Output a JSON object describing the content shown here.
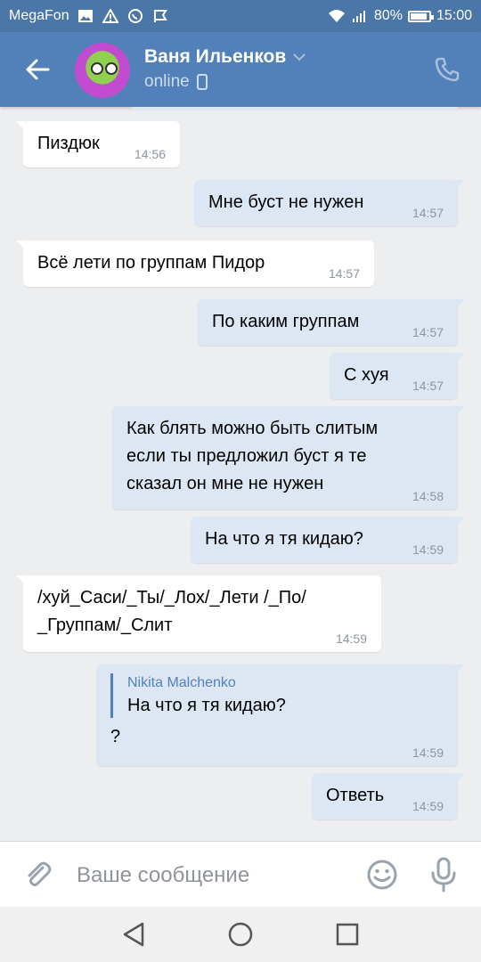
{
  "status_bar": {
    "carrier": "MegaFon",
    "battery": "80%",
    "time": "15:00"
  },
  "header": {
    "contact_name": "Ваня Ильенков",
    "status": "online",
    "icons": {
      "back": "arrow-left-icon",
      "call": "phone-icon",
      "dropdown": "chevron-down-icon",
      "device": "mobile-icon"
    }
  },
  "messages": [
    {
      "dir": "in",
      "text": "Пиздюк",
      "time": "14:56"
    },
    {
      "dir": "out",
      "text": "Мне буст не нужен",
      "time": "14:57"
    },
    {
      "dir": "in",
      "text": "Всё лети по группам Пидор",
      "time": "14:57"
    },
    {
      "dir": "out",
      "text": "По каким группам",
      "time": "14:57"
    },
    {
      "dir": "out",
      "text": "С хуя",
      "time": "14:57"
    },
    {
      "dir": "out",
      "text": "Как блять можно быть слитым\nесли ты предложил буст я те\nсказал он мне не нужен",
      "time": "14:58"
    },
    {
      "dir": "out",
      "text": "На что я тя кидаю?",
      "time": "14:59"
    },
    {
      "dir": "in",
      "text": "/хуй_Саси/_Ты/_Лох/_Лети /_По/\n_Группам/_Слит",
      "time": "14:59"
    },
    {
      "dir": "out",
      "reply_author": "Nikita Malchenko",
      "reply_text": "На что я тя кидаю?",
      "text": "?",
      "time": "14:59"
    },
    {
      "dir": "out",
      "text": "Ответь",
      "time": "14:59"
    }
  ],
  "input": {
    "placeholder": "Ваше сообщение",
    "value": "",
    "icons": {
      "attach": "paperclip-icon",
      "emoji": "smiley-icon",
      "mic": "microphone-icon"
    }
  },
  "nav": {
    "icons": [
      "back-triangle-icon",
      "home-circle-icon",
      "recents-square-icon"
    ]
  },
  "colors": {
    "header": "#5181b8",
    "status_bar": "#4a76a8",
    "outgoing_bubble": "#dde7f3",
    "incoming_bubble": "#ffffff",
    "background": "#edeef0"
  }
}
